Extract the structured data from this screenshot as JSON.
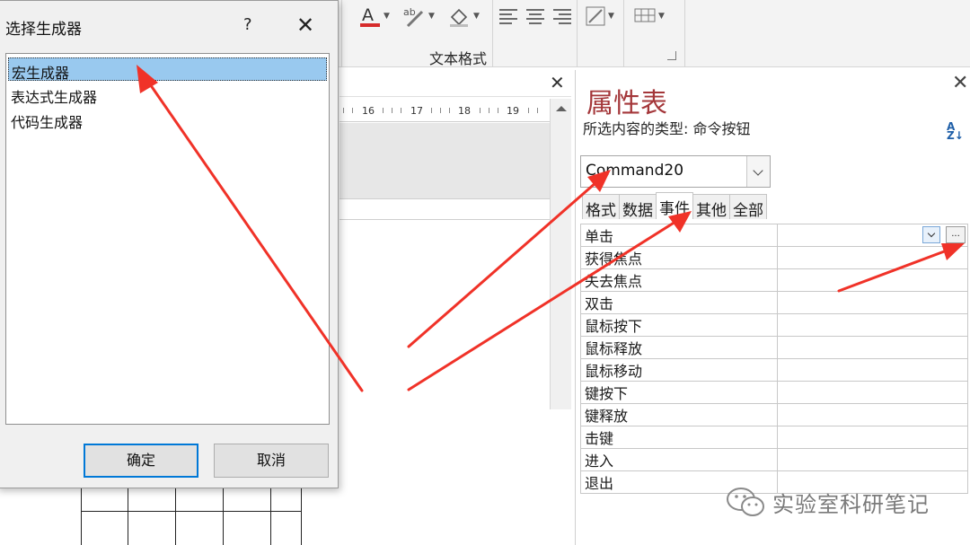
{
  "ribbon": {
    "group_label": "文本格式",
    "icons": [
      "font-color-icon",
      "highlight-icon",
      "fill-color-icon",
      "align-left-icon",
      "align-center-icon",
      "align-right-icon",
      "conditional-format-icon",
      "gridlines-icon"
    ]
  },
  "document": {
    "close_symbol": "✕",
    "ruler_labels": [
      "16",
      "17",
      "18",
      "19"
    ]
  },
  "property_sheet": {
    "title": "属性表",
    "close_symbol": "✕",
    "selection_type_label": "所选内容的类型: 命令按钮",
    "sort_icon_text": "A\nZ",
    "selected_object": "Command20",
    "tabs": [
      {
        "label": "格式",
        "active": false
      },
      {
        "label": "数据",
        "active": false
      },
      {
        "label": "事件",
        "active": true
      },
      {
        "label": "其他",
        "active": false
      },
      {
        "label": "全部",
        "active": false
      }
    ],
    "rows": [
      {
        "name": "单击"
      },
      {
        "name": "获得焦点"
      },
      {
        "name": "失去焦点"
      },
      {
        "name": "双击"
      },
      {
        "name": "鼠标按下"
      },
      {
        "name": "鼠标释放"
      },
      {
        "name": "鼠标移动"
      },
      {
        "name": "键按下"
      },
      {
        "name": "键释放"
      },
      {
        "name": "击键"
      },
      {
        "name": "进入"
      },
      {
        "name": "退出"
      }
    ],
    "builder_button": "..."
  },
  "dialog": {
    "title": "选择生成器",
    "help_symbol": "?",
    "close_symbol": "✕",
    "items": [
      {
        "label": "宏生成器",
        "selected": true
      },
      {
        "label": "表达式生成器",
        "selected": false
      },
      {
        "label": "代码生成器",
        "selected": false
      }
    ],
    "ok_label": "确定",
    "cancel_label": "取消"
  },
  "watermark": {
    "text": "实验室科研笔记",
    "icon": "wechat-icon"
  },
  "colors": {
    "title_red": "#a4373a",
    "selection_blue": "#99c9ef",
    "arrow_red": "#f03228"
  }
}
